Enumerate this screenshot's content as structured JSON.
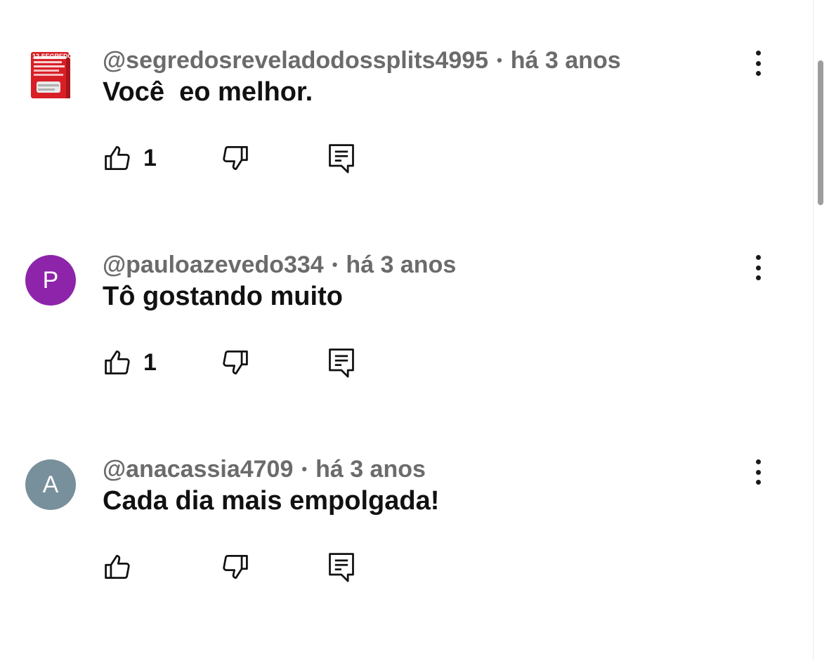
{
  "comments": [
    {
      "author": "@segredosreveladodossplits4995",
      "time": "há 3 anos",
      "text": "Você  eo melhor.",
      "likes": "1",
      "avatar": {
        "type": "thumbnail",
        "color": "#d81f26",
        "label": "12 SEGREDOS"
      }
    },
    {
      "author": "@pauloazevedo334",
      "time": "há 3 anos",
      "text": "Tô gostando muito",
      "likes": "1",
      "avatar": {
        "type": "letter",
        "letter": "P",
        "color": "#8e24aa"
      }
    },
    {
      "author": "@anacassia4709",
      "time": "há 3 anos",
      "text": "Cada dia mais empolgada!",
      "likes": "",
      "avatar": {
        "type": "letter",
        "letter": "A",
        "color": "#78909c"
      }
    }
  ],
  "separator": "•",
  "icons": {
    "like": "thumbs-up-icon",
    "dislike": "thumbs-down-icon",
    "reply": "reply-comment-icon",
    "more": "more-vert-icon"
  }
}
